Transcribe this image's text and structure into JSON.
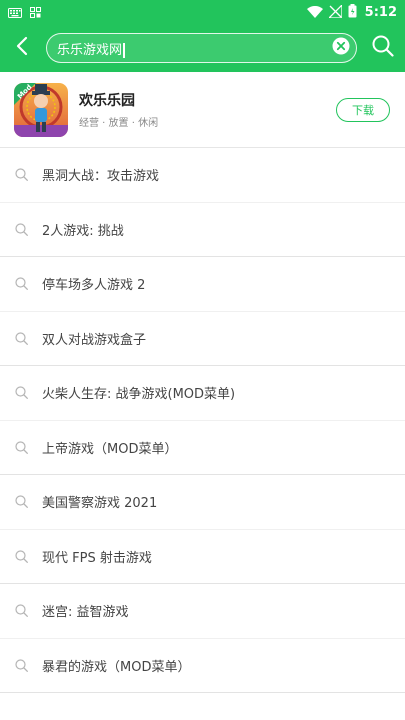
{
  "status_bar": {
    "time": "5:12",
    "icons": [
      "keyboard-icon",
      "screenshot-icon",
      "wifi-icon",
      "no-signal-icon",
      "battery-icon"
    ]
  },
  "search": {
    "query": "乐乐游戏网",
    "icons": [
      "back-arrow-icon",
      "clear-icon",
      "search-icon"
    ]
  },
  "app_card": {
    "name": "欢乐乐园",
    "tags": "经营 · 放置 · 休闲",
    "badge": "Mod",
    "download_label": "下载"
  },
  "suggestions": [
    "黑洞大战：攻击游戏",
    "2人游戏: 挑战",
    "停车场多人游戏 2",
    "双人对战游戏盒子",
    "火柴人生存: 战争游戏(MOD菜单)",
    "上帝游戏（MOD菜单）",
    "美国警察游戏 2021",
    "现代 FPS 射击游戏",
    "迷宫: 益智游戏",
    "暴君的游戏（MOD菜单）"
  ],
  "colors": {
    "accent": "#22c45c",
    "text": "#444444",
    "muted": "#888888"
  }
}
